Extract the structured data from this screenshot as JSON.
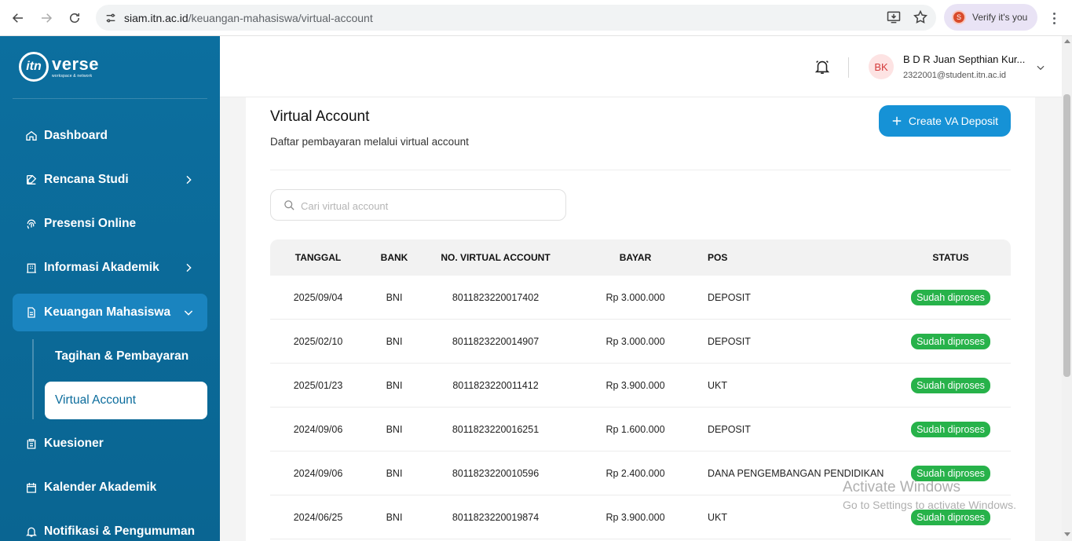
{
  "browser": {
    "url_host": "siam.itn.ac.id",
    "url_path": "/keuangan-mahasiswa/virtual-account",
    "verify_label": "Verify it's you",
    "verify_initial": "S"
  },
  "sidebar": {
    "logo_text": "verse",
    "logo_mark": "itn",
    "logo_tagline": "workspace & network",
    "items": [
      {
        "label": "Dashboard",
        "icon": "home-icon"
      },
      {
        "label": "Rencana Studi",
        "icon": "edit-icon"
      },
      {
        "label": "Presensi Online",
        "icon": "fingerprint-icon"
      },
      {
        "label": "Informasi Akademik",
        "icon": "building-icon"
      },
      {
        "label": "Keuangan Mahasiswa",
        "icon": "document-icon"
      },
      {
        "label": "Kuesioner",
        "icon": "clipboard-icon"
      },
      {
        "label": "Kalender Akademik",
        "icon": "calendar-icon"
      },
      {
        "label": "Notifikasi & Pengumuman",
        "icon": "bell-icon"
      }
    ],
    "subitems": [
      {
        "label": "Tagihan & Pembayaran"
      },
      {
        "label": "Virtual Account"
      }
    ]
  },
  "header": {
    "avatar_initials": "BK",
    "user_name": "B D R Juan Septhian Kur...",
    "user_email": "2322001@student.itn.ac.id"
  },
  "page": {
    "title": "Virtual Account",
    "subtitle": "Daftar pembayaran melalui virtual account",
    "create_button": "Create VA Deposit",
    "search_placeholder": "Cari virtual account"
  },
  "table": {
    "headers": {
      "date": "TANGGAL",
      "bank": "BANK",
      "va": "NO. VIRTUAL ACCOUNT",
      "bayar": "BAYAR",
      "pos": "POS",
      "status": "STATUS"
    },
    "rows": [
      {
        "date": "2025/09/04",
        "bank": "BNI",
        "va": "8011823220017402",
        "bayar": "Rp 3.000.000",
        "pos": "DEPOSIT",
        "status": "Sudah diproses"
      },
      {
        "date": "2025/02/10",
        "bank": "BNI",
        "va": "8011823220014907",
        "bayar": "Rp 3.000.000",
        "pos": "DEPOSIT",
        "status": "Sudah diproses"
      },
      {
        "date": "2025/01/23",
        "bank": "BNI",
        "va": "8011823220011412",
        "bayar": "Rp 3.900.000",
        "pos": "UKT",
        "status": "Sudah diproses"
      },
      {
        "date": "2024/09/06",
        "bank": "BNI",
        "va": "8011823220016251",
        "bayar": "Rp 1.600.000",
        "pos": "DEPOSIT",
        "status": "Sudah diproses"
      },
      {
        "date": "2024/09/06",
        "bank": "BNI",
        "va": "8011823220010596",
        "bayar": "Rp 2.400.000",
        "pos": "DANA PENGEMBANGAN PENDIDIKAN",
        "status": "Sudah diproses"
      },
      {
        "date": "2024/06/25",
        "bank": "BNI",
        "va": "8011823220019874",
        "bayar": "Rp 3.900.000",
        "pos": "UKT",
        "status": "Sudah diproses"
      }
    ]
  },
  "watermark": {
    "title": "Activate Windows",
    "subtitle": "Go to Settings to activate Windows."
  },
  "colors": {
    "sidebar": "#0b6c9c",
    "accent": "#1692d6",
    "status_green": "#27b24a"
  }
}
